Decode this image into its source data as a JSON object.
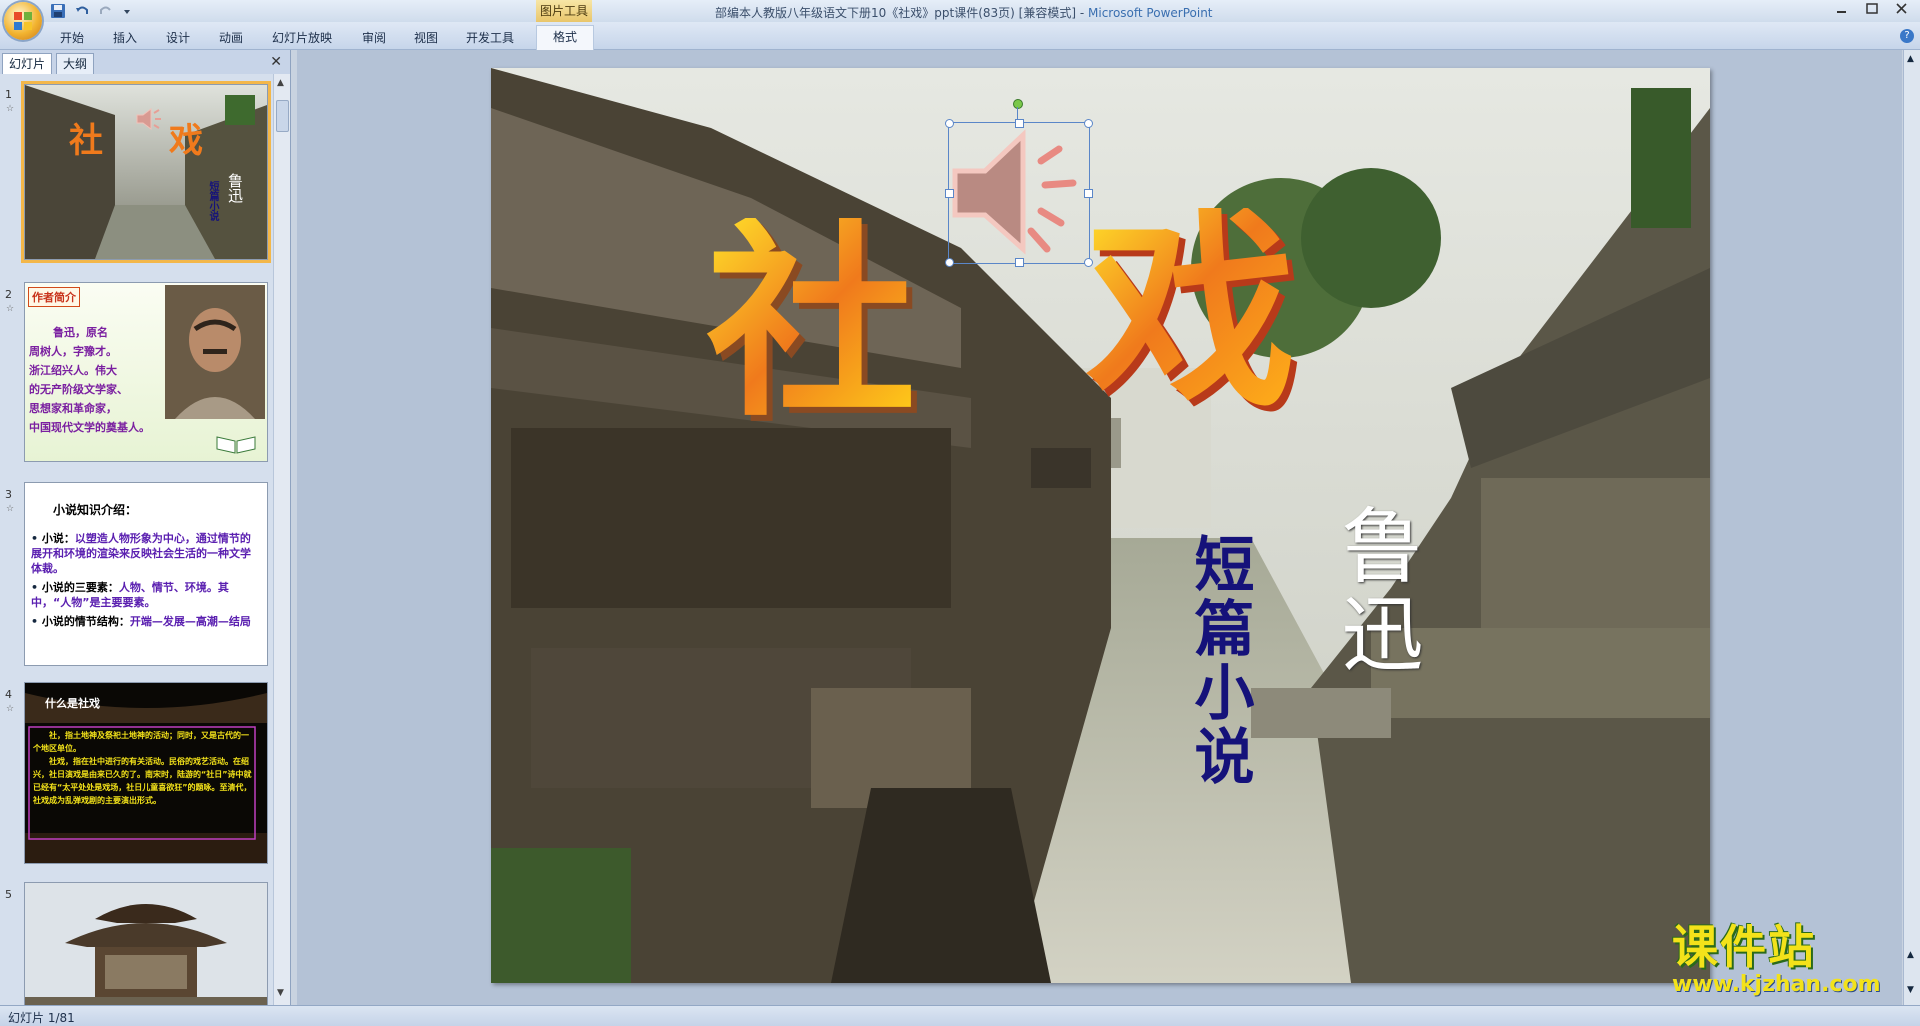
{
  "window": {
    "title": "部编本人教版八年级语文下册10《社戏》ppt课件(83页) [兼容模式]",
    "title_sep": " - ",
    "app_name": "Microsoft PowerPoint",
    "context_tab_group": "图片工具"
  },
  "ribbon": {
    "tabs": [
      "开始",
      "插入",
      "设计",
      "动画",
      "幻灯片放映",
      "审阅",
      "视图",
      "开发工具",
      "格式"
    ]
  },
  "panel": {
    "tab_slides": "幻灯片",
    "tab_outline": "大纲",
    "close": "✕",
    "thumbs": [
      {
        "num": "1",
        "title_chars": [
          "社",
          "戏"
        ],
        "author": "鲁迅",
        "sub": "短篇小说"
      },
      {
        "num": "2",
        "badge": "作者简介",
        "lines": [
          "鲁迅，原名",
          "周树人，字豫才。",
          "浙江绍兴人。伟大",
          "的无产阶级文学家、",
          "思想家和革命家，",
          "中国现代文学的奠基人。"
        ]
      },
      {
        "num": "3",
        "heading": "小说知识介绍：",
        "items": [
          {
            "label": "小说：",
            "text": "以塑造人物形象为中心，通过情节的展开和环境的渲染来反映社会生活的一种文学体裁。"
          },
          {
            "label": "小说的三要素：",
            "text": "人物、情节、环境。其中，“人物”是主要要素。"
          },
          {
            "label": "小说的情节结构：",
            "text": "开端—发展—高潮—结局"
          }
        ]
      },
      {
        "num": "4",
        "heading": "什么是社戏",
        "lines": [
          "社，指土地神及祭祀土地神的活动；同时，又是古代的一个地区单位。",
          "社戏，指在社中进行的有关活动。民俗的戏艺活动。在绍兴，社日演戏是由来已久的了。南宋时，陆游的“社日”诗中就已经有“太平处处是戏场，社日儿童喜欲狂”的题咏。至清代，社戏成为乱弹戏剧的主要演出形式。"
        ]
      },
      {
        "num": "5"
      }
    ]
  },
  "slide": {
    "title_char_1": "社",
    "title_char_2": "戏",
    "subtitle": "短篇小说",
    "author": "鲁迅"
  },
  "watermark": {
    "cn": "课件站",
    "url": "www.kjzhan.com"
  },
  "status": {
    "slide_counter": "幻灯片 1/81"
  },
  "colors": {
    "accent_orange": "#f07a1c",
    "subtitle_blue": "#15127a",
    "watermark_yellow": "#f3e21a"
  }
}
